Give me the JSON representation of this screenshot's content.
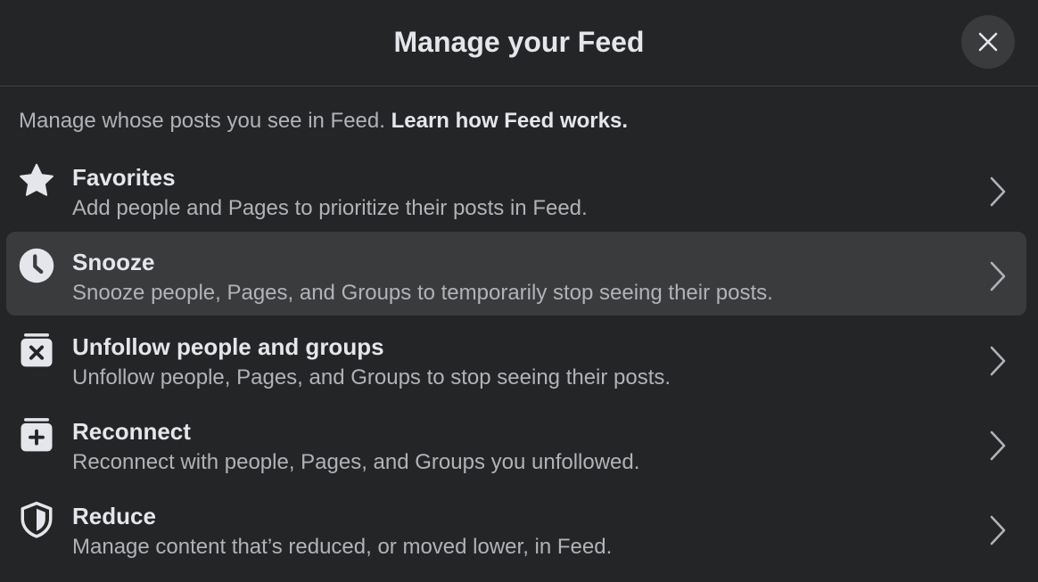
{
  "header": {
    "title": "Manage your Feed",
    "close_icon": "close-icon"
  },
  "intro": {
    "text": "Manage whose posts you see in Feed.",
    "link": "Learn how Feed works."
  },
  "items": [
    {
      "title": "Favorites",
      "description": "Add people and Pages to prioritize their posts in Feed.",
      "icon": "star-icon"
    },
    {
      "title": "Snooze",
      "description": "Snooze people, Pages, and Groups to temporarily stop seeing their posts.",
      "icon": "clock-icon"
    },
    {
      "title": "Unfollow people and groups",
      "description": "Unfollow people, Pages, and Groups to stop seeing their posts.",
      "icon": "unfollow-icon"
    },
    {
      "title": "Reconnect",
      "description": "Reconnect with people, Pages, and Groups you unfollowed.",
      "icon": "reconnect-icon"
    },
    {
      "title": "Reduce",
      "description": "Manage content that’s reduced, or moved lower, in Feed.",
      "icon": "shield-icon"
    }
  ],
  "colors": {
    "background": "#242526",
    "highlight": "#3a3b3c",
    "primary_text": "#e4e6eb",
    "secondary_text": "#b0b3b8",
    "divider": "#3e4042"
  }
}
